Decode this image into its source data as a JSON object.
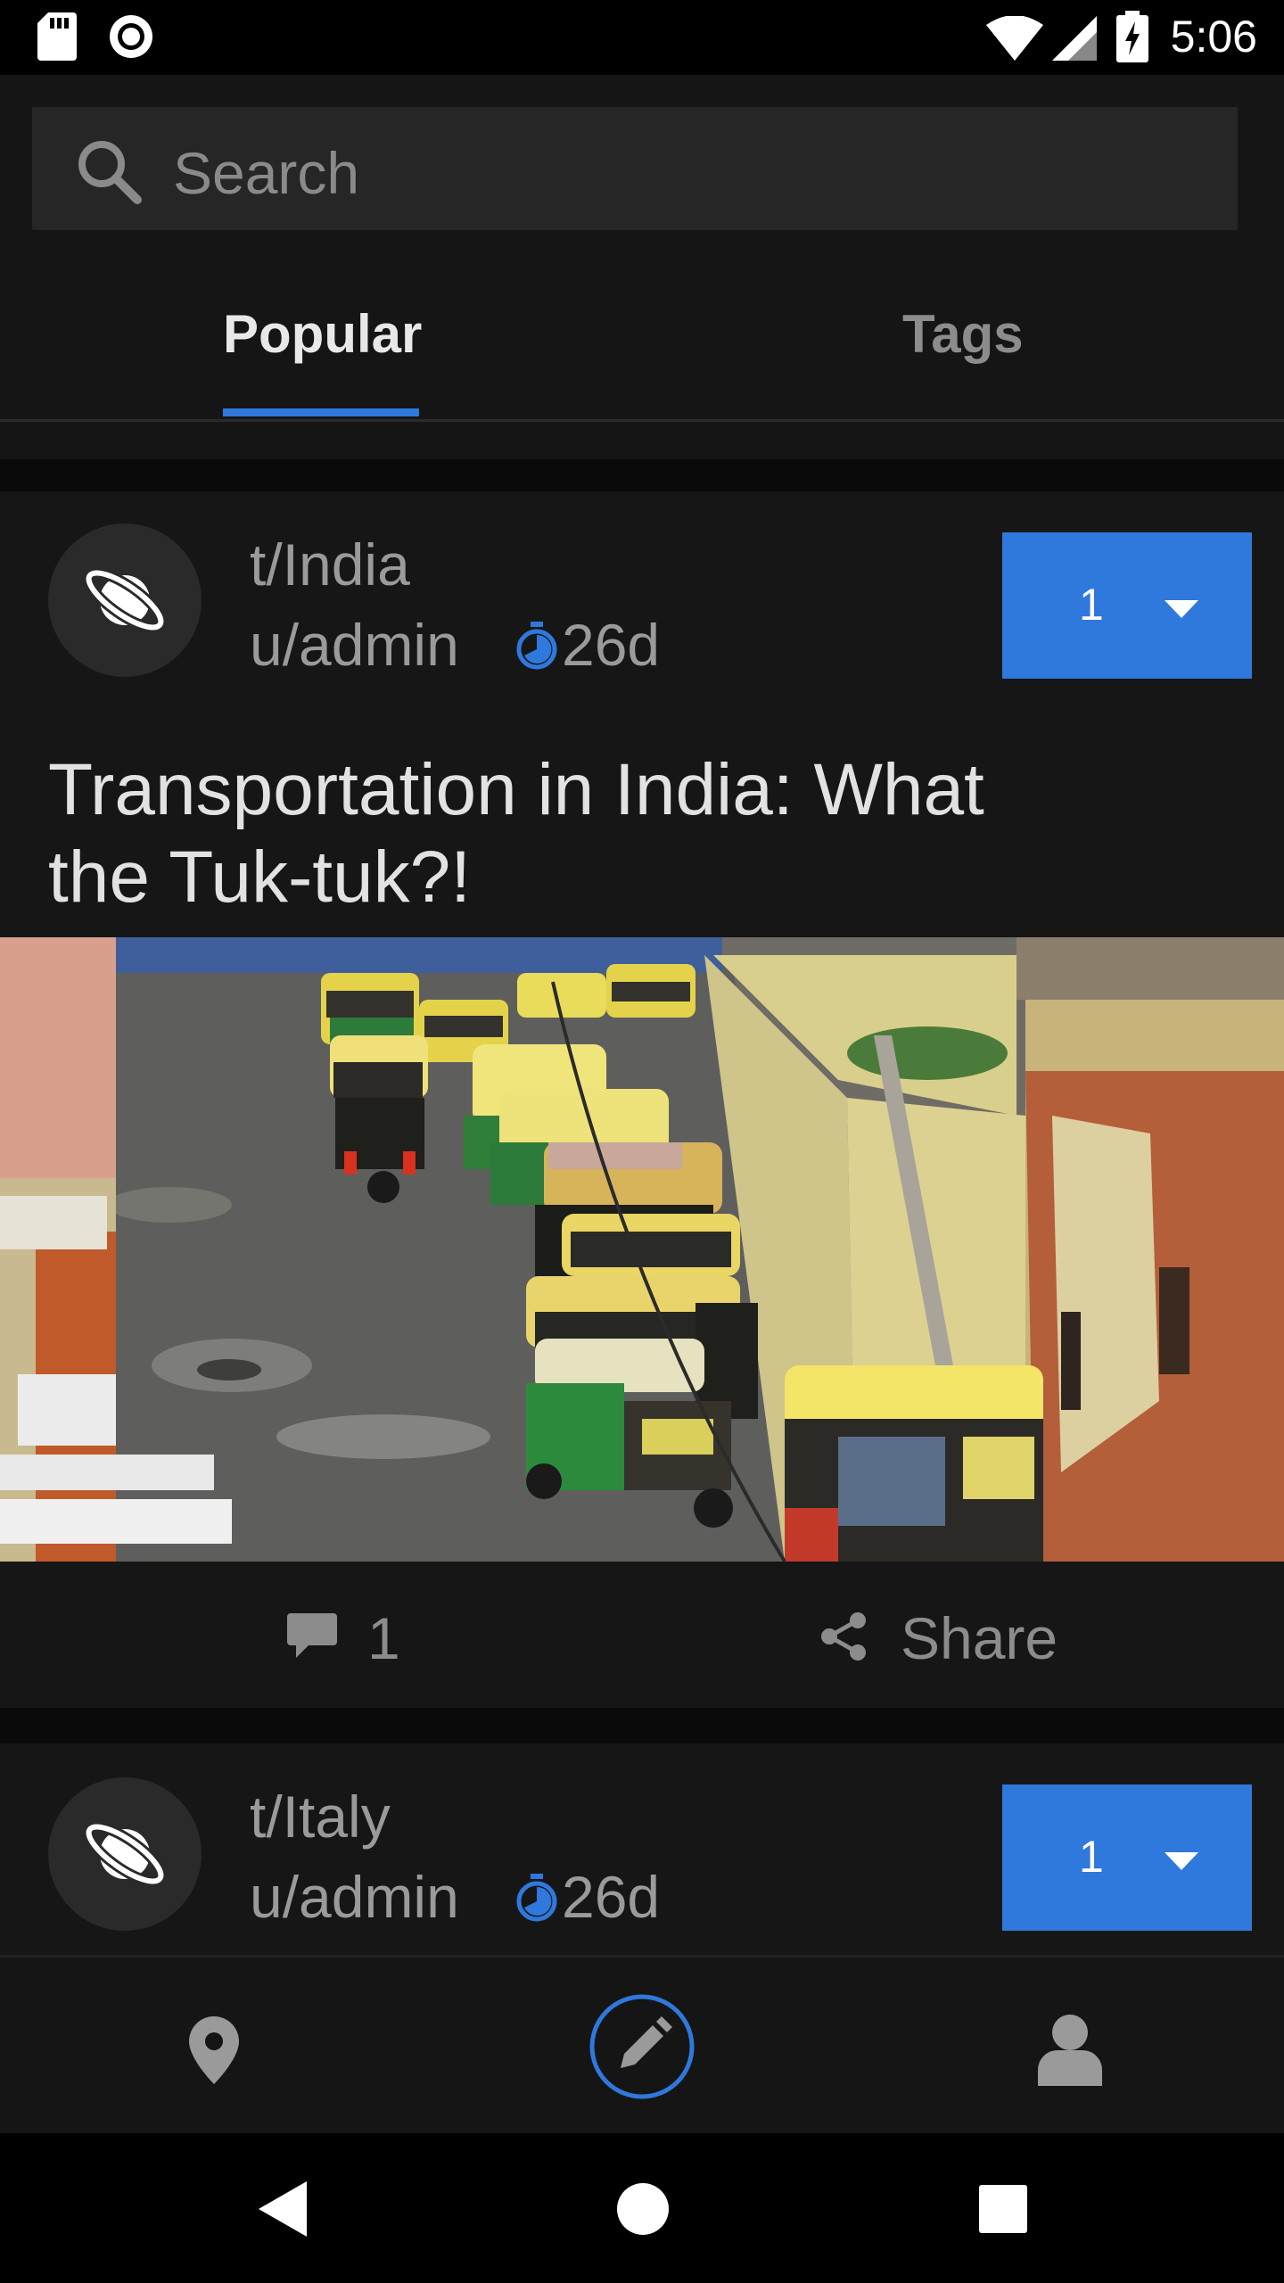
{
  "status_bar": {
    "time": "5:06"
  },
  "search": {
    "placeholder": "Search"
  },
  "tabs": [
    {
      "label": "Popular",
      "selected": true
    },
    {
      "label": "Tags",
      "selected": false
    }
  ],
  "posts": [
    {
      "community": "t/India",
      "user": "u/admin",
      "age": "26d",
      "votes": "1",
      "title": "Transportation in India: What the Tuk-tuk?!",
      "comments": "1",
      "share_label": "Share"
    },
    {
      "community": "t/Italy",
      "user": "u/admin",
      "age": "26d",
      "votes": "1"
    }
  ],
  "bottom_nav": [
    "map-pin-icon",
    "compose-icon",
    "profile-icon"
  ],
  "colors": {
    "accent": "#2f78dc",
    "background": "#111111",
    "card": "#161616"
  }
}
